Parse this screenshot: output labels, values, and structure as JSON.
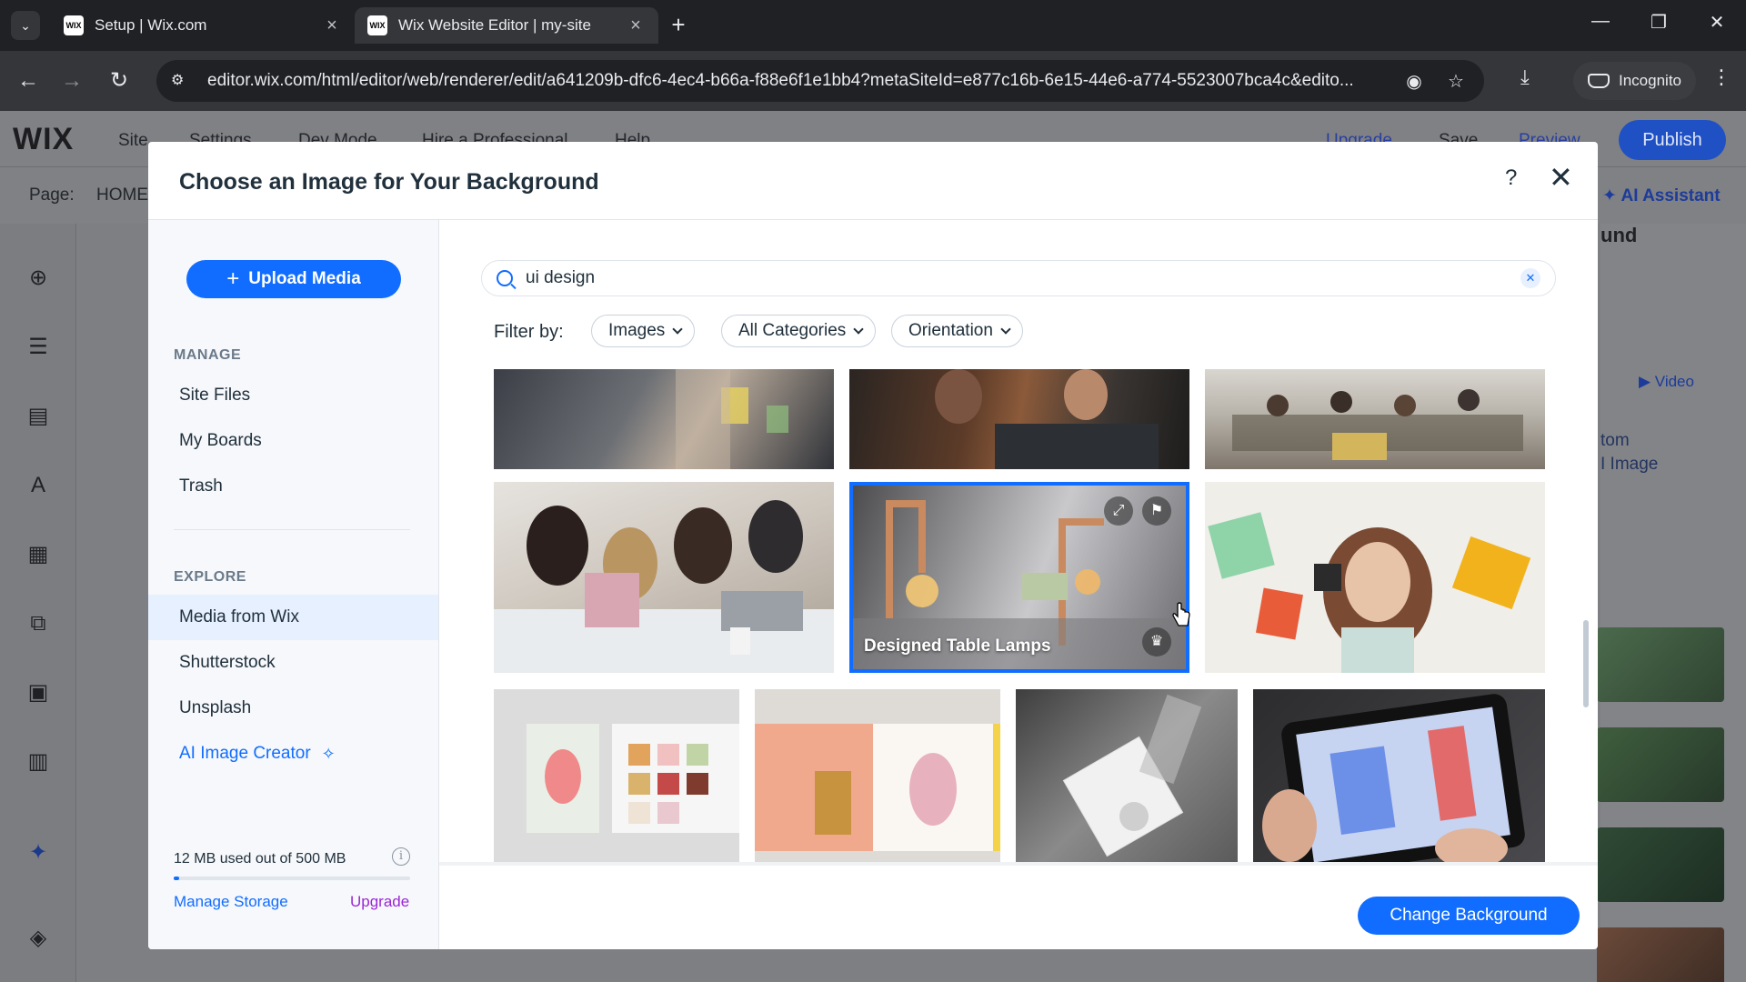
{
  "browser": {
    "tabs": [
      {
        "title": "Setup | Wix.com",
        "favicon": "WIX",
        "active": false
      },
      {
        "title": "Wix Website Editor | my-site",
        "favicon": "WIX",
        "active": true
      }
    ],
    "url": "editor.wix.com/html/editor/web/renderer/edit/a641209b-dfc6-4ec4-b66a-f88e6f1e1bb4?metaSiteId=e877c16b-6e15-44e6-a774-5523007bca4c&edito...",
    "incognito_label": "Incognito"
  },
  "editor": {
    "logo": "WIX",
    "menu": [
      "Site",
      "Settings",
      "Dev Mode",
      "Hire a Professional",
      "Help"
    ],
    "right_menu": [
      "Upgrade",
      "Save",
      "Preview"
    ],
    "publish": "Publish",
    "page_label": "Page:",
    "page_name": "HOME",
    "ai_assistant": "AI Assistant",
    "right_panel_heading": "und",
    "right_panel_video": "Video",
    "right_panel_custom": "tom",
    "right_panel_ai_image": "I Image"
  },
  "modal": {
    "title": "Choose an Image for Your Background",
    "help": "?",
    "close": "✕",
    "upload_button": "Upload Media",
    "manage_heading": "MANAGE",
    "manage_items": [
      "Site Files",
      "My Boards",
      "Trash"
    ],
    "explore_heading": "EXPLORE",
    "explore_items": [
      "Media from Wix",
      "Shutterstock",
      "Unsplash",
      "AI Image Creator"
    ],
    "selected_explore": "Media from Wix",
    "storage": {
      "text": "12 MB used out of 500 MB",
      "used_fraction": 0.024,
      "manage": "Manage Storage",
      "upgrade": "Upgrade"
    },
    "search": {
      "value": "ui design",
      "placeholder": "Search"
    },
    "filter_label": "Filter by:",
    "filters": [
      "Images",
      "All Categories",
      "Orientation"
    ],
    "selected_image_caption": "Designed Table Lamps",
    "change_button": "Change Background"
  },
  "colors": {
    "accent": "#116dff",
    "upgrade": "#9a27d5",
    "selected_bg": "#e7f0ff"
  }
}
